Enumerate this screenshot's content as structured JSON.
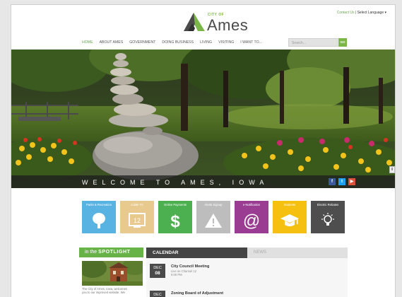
{
  "header": {
    "contact_label": "Contact Us",
    "separator": "|",
    "language_label": "Select Language ▾",
    "logo": {
      "city_of": "CITY OF",
      "name": "Ames"
    }
  },
  "nav": {
    "items": [
      "HOME",
      "ABOUT AMES",
      "GOVERNMENT",
      "DOING BUSINESS",
      "LIVING",
      "VISITING",
      "I WANT TO..."
    ],
    "active_index": 0
  },
  "search": {
    "placeholder": "Search...",
    "go_label": "GO"
  },
  "hero": {
    "caption": "WELCOME TO AMES, IOWA",
    "social": {
      "facebook": "f",
      "twitter": "t",
      "youtube": "▶"
    },
    "toggle_symbol": "II"
  },
  "tiles": [
    {
      "label": "Parks & Recreation",
      "icon": "tree-icon",
      "color": "#59b3e2"
    },
    {
      "label": "Cable TV",
      "icon": "tv-icon",
      "color": "#e8c98e"
    },
    {
      "label": "Online Payments",
      "icon": "dollar-icon",
      "color": "#4caf50"
    },
    {
      "label": "Alerts Signup",
      "icon": "warning-icon",
      "color": "#bdbdbd"
    },
    {
      "label": "e-Notification",
      "icon": "at-sign-icon",
      "color": "#9a3d92"
    },
    {
      "label": "Students",
      "icon": "graduation-cap-icon",
      "color": "#f5c010"
    },
    {
      "label": "Electric Rebates",
      "icon": "lightbulb-icon",
      "color": "#4e4e4e"
    }
  ],
  "spotlight": {
    "prefix": "in the",
    "title": "SPOTLIGHT",
    "text_line1": "The City of Ames, Iowa, welcomes",
    "text_line2": "you to our improved website. We"
  },
  "calendar": {
    "tab_label": "CALENDAR",
    "news_label": "NEWS",
    "events": [
      {
        "month": "DEC",
        "day": "08",
        "title": "City Council Meeting",
        "sub1": "Live on Channel 12",
        "sub2": "6:00 PM"
      },
      {
        "month": "DEC",
        "day": "",
        "title": "Zoning Board of Adjustment",
        "sub1": "",
        "sub2": ""
      }
    ]
  },
  "colors": {
    "accent_green": "#7ab648",
    "dark_gray": "#444444"
  }
}
